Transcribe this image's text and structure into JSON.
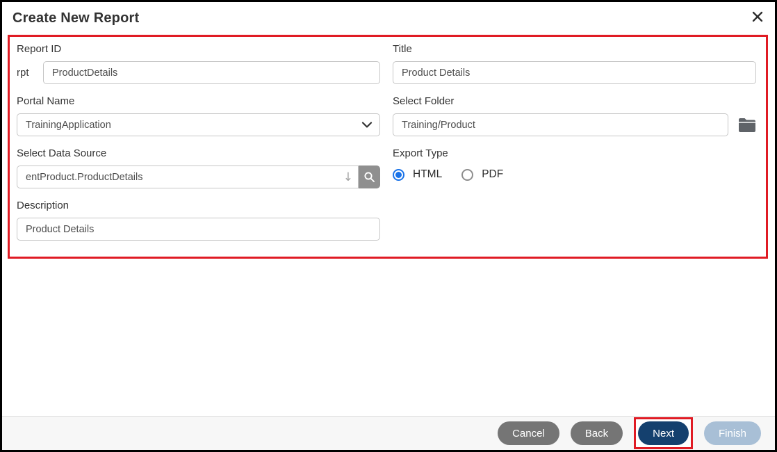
{
  "dialog": {
    "title": "Create New Report"
  },
  "form": {
    "report_id": {
      "label": "Report ID",
      "prefix": "rpt",
      "value": "ProductDetails"
    },
    "title_field": {
      "label": "Title",
      "value": "Product Details"
    },
    "portal_name": {
      "label": "Portal Name",
      "selected_option": "TrainingApplication"
    },
    "select_folder": {
      "label": "Select Folder",
      "value": "Training/Product"
    },
    "data_source": {
      "label": "Select Data Source",
      "value": "entProduct.ProductDetails"
    },
    "export_type": {
      "label": "Export Type",
      "options": [
        {
          "label": "HTML",
          "selected": true
        },
        {
          "label": "PDF",
          "selected": false
        }
      ]
    },
    "description": {
      "label": "Description",
      "value": "Product Details"
    }
  },
  "footer": {
    "buttons": [
      {
        "label": "Cancel",
        "style": "gray",
        "enabled": true,
        "highlighted": false
      },
      {
        "label": "Back",
        "style": "gray",
        "enabled": true,
        "highlighted": false
      },
      {
        "label": "Next",
        "style": "primary",
        "enabled": true,
        "highlighted": true
      },
      {
        "label": "Finish",
        "style": "disabled",
        "enabled": false,
        "highlighted": false
      }
    ]
  },
  "icons": {
    "close": "✕",
    "dropdown_chevron": "⌄",
    "data_source_arrow": "↓",
    "search": "magnifier",
    "folder": "folder"
  },
  "colors": {
    "highlight_red": "#e01b24",
    "primary_navy": "#14406e",
    "button_gray": "#757575",
    "disabled_blue": "#a8bfd6",
    "radio_blue": "#1a73e8",
    "folder_gray": "#5f6368"
  }
}
